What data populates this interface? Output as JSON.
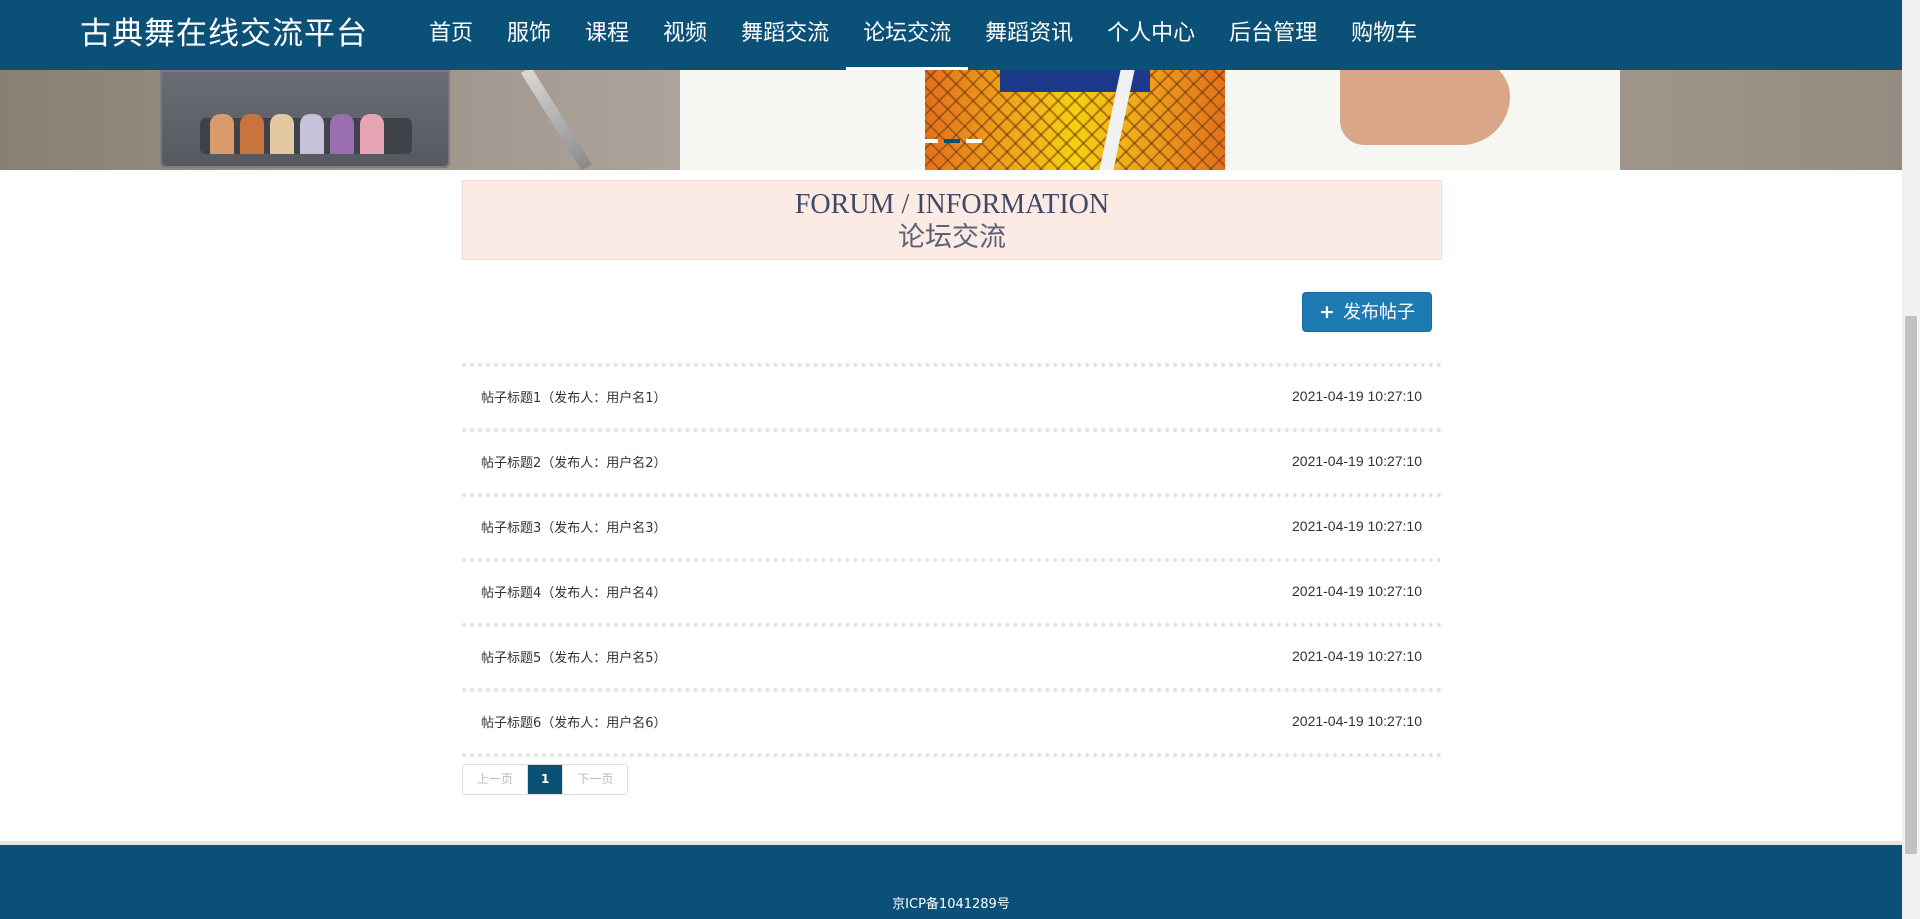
{
  "header": {
    "brand": "古典舞在线交流平台",
    "nav": [
      {
        "label": "首页"
      },
      {
        "label": "服饰"
      },
      {
        "label": "课程"
      },
      {
        "label": "视频"
      },
      {
        "label": "舞蹈交流"
      },
      {
        "label": "论坛交流",
        "active": true
      },
      {
        "label": "舞蹈资讯"
      },
      {
        "label": "个人中心"
      },
      {
        "label": "后台管理"
      },
      {
        "label": "购物车"
      }
    ]
  },
  "banner": {
    "slide_count": 3,
    "active_slide": 2
  },
  "section": {
    "title_en": "FORUM / INFORMATION",
    "title_cn": "论坛交流"
  },
  "actions": {
    "publish_icon": "+",
    "publish_label": "发布帖子"
  },
  "posts": [
    {
      "title": "帖子标题1（发布人：用户名1）",
      "time": "2021-04-19 10:27:10"
    },
    {
      "title": "帖子标题2（发布人：用户名2）",
      "time": "2021-04-19 10:27:10"
    },
    {
      "title": "帖子标题3（发布人：用户名3）",
      "time": "2021-04-19 10:27:10"
    },
    {
      "title": "帖子标题4（发布人：用户名4）",
      "time": "2021-04-19 10:27:10"
    },
    {
      "title": "帖子标题5（发布人：用户名5）",
      "time": "2021-04-19 10:27:10"
    },
    {
      "title": "帖子标题6（发布人：用户名6）",
      "time": "2021-04-19 10:27:10"
    }
  ],
  "pagination": {
    "prev": "上一页",
    "current": "1",
    "next": "下一页"
  },
  "footer": {
    "icp": "京ICP备1041289号"
  },
  "colors": {
    "primary": "#0b5077",
    "button": "#1e7ab3",
    "section_bg": "#fcebe4"
  }
}
